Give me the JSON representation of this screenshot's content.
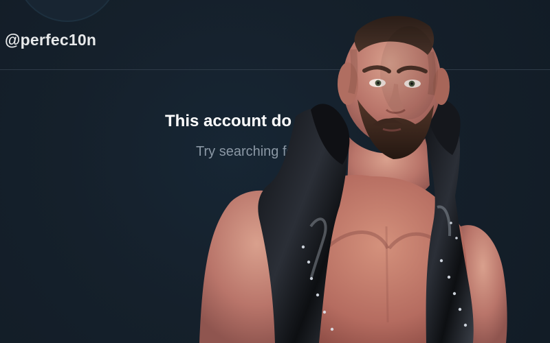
{
  "profile": {
    "handle": "@perfec10n"
  },
  "empty_state": {
    "title": "This account do",
    "subtitle": "Try searching for"
  },
  "photo": {
    "subject": "bald bearded man in a black studded vest",
    "icon": "person-photo"
  },
  "colors": {
    "background": "#15202b",
    "divider": "#2f3b48",
    "primary_text": "#ffffff",
    "secondary_text": "#8b98a5"
  }
}
